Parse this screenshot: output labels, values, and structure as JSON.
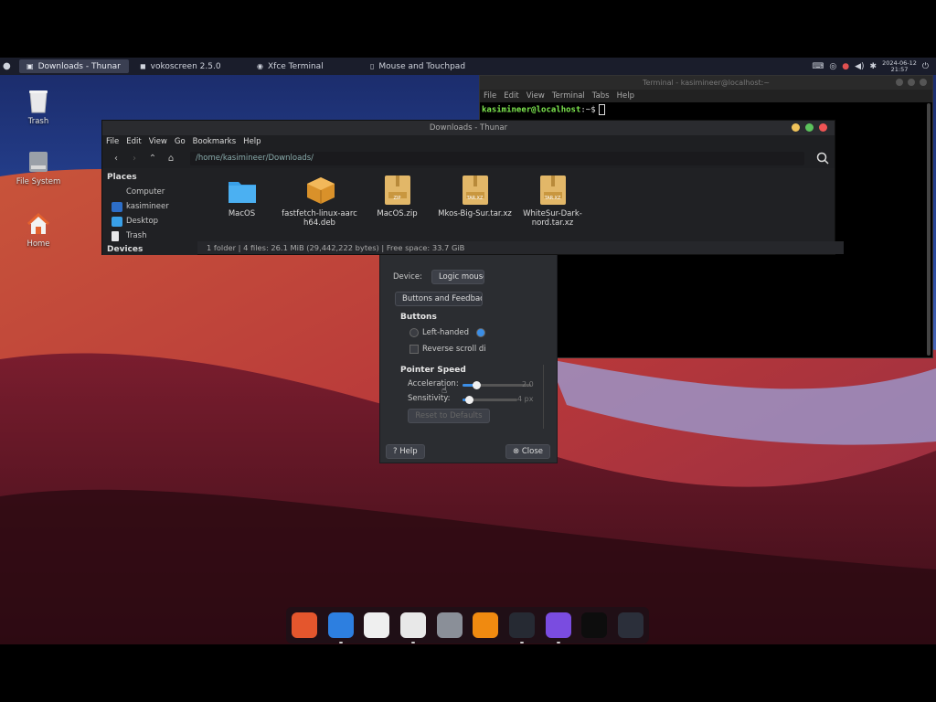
{
  "colors": {
    "panel_bg": "#1a1d2b",
    "terminal_prompt": "#7ee84f",
    "folder_blue": "#39a0e8",
    "archive_tan": "#e2b768",
    "close_red": "#f05454",
    "max_green": "#5cc25c",
    "min_yellow": "#f0c35a"
  },
  "top_panel": {
    "tasks": [
      {
        "label": "Downloads - Thunar",
        "icon": "folder-icon",
        "active": true
      },
      {
        "label": "vokoscreen 2.5.0",
        "icon": "camera-icon",
        "active": false
      },
      {
        "label": "Xfce Terminal",
        "icon": "terminal-icon",
        "active": false
      },
      {
        "label": "Mouse and Touchpad",
        "icon": "mouse-icon",
        "active": false
      }
    ],
    "clock_date": "2024-06-12",
    "clock_time": "21:57"
  },
  "desktop": {
    "icons": [
      {
        "label": "Trash",
        "icon": "trash-icon"
      },
      {
        "label": "File System",
        "icon": "drive-icon"
      },
      {
        "label": "Home",
        "icon": "home-icon"
      }
    ]
  },
  "terminal": {
    "title": "Terminal - kasimineer@localhost:~",
    "menu": [
      "File",
      "Edit",
      "View",
      "Terminal",
      "Tabs",
      "Help"
    ],
    "prompt_user": "kasimineer@localhost",
    "prompt_tail": ":~$"
  },
  "mouse_dialog": {
    "device_label": "Device:",
    "device_value": "Logic mouse",
    "tab": "Buttons and Feedback",
    "buttons_heading": "Buttons",
    "left_handed": "Left-handed",
    "reverse_scroll": "Reverse scroll di",
    "speed_heading": "Pointer Speed",
    "acceleration_label": "Acceleration:",
    "acceleration_value": "2.0",
    "sensitivity_label": "Sensitivity:",
    "sensitivity_value": "4 px",
    "reset_label": "Reset to Defaults",
    "help_label": "Help",
    "close_label": "Close",
    "acceleration_fraction": 0.2,
    "sensitivity_fraction": 0.12
  },
  "thunar": {
    "title": "Downloads - Thunar",
    "menu": [
      "File",
      "Edit",
      "View",
      "Go",
      "Bookmarks",
      "Help"
    ],
    "path": "/home/kasimineer/Downloads/",
    "sidebar": {
      "places_heading": "Places",
      "items": [
        {
          "label": "Computer",
          "icon": "computer-icon"
        },
        {
          "label": "kasimineer",
          "icon": "home-folder-icon"
        },
        {
          "label": "Desktop",
          "icon": "desktop-folder-icon"
        },
        {
          "label": "Trash",
          "icon": "trash-icon"
        }
      ],
      "devices_heading": "Devices"
    },
    "files": [
      {
        "name": "MacOS",
        "icon": "folder-icon",
        "badge": ""
      },
      {
        "name": "fastfetch-linux-aarch64.deb",
        "icon": "package-icon",
        "badge": ""
      },
      {
        "name": "MacOS.zip",
        "icon": "archive-icon",
        "badge": "ZIP"
      },
      {
        "name": "Mkos-Big-Sur.tar.xz",
        "icon": "archive-icon",
        "badge": "TAR.XZ"
      },
      {
        "name": "WhiteSur-Dark-nord.tar.xz",
        "icon": "archive-icon",
        "badge": "TAR.XZ"
      }
    ],
    "status": "1 folder  |  4 files: 26.1 MiB (29,442,222 bytes)  |  Free space: 33.7 GiB"
  },
  "dock": {
    "items": [
      {
        "name": "firefox-icon",
        "bg": "#e4562d",
        "running": false
      },
      {
        "name": "finder-icon",
        "bg": "#2d7fe0",
        "running": true
      },
      {
        "name": "home-icon",
        "bg": "#efefef",
        "running": false
      },
      {
        "name": "mouse-settings-icon",
        "bg": "#e8e8e8",
        "running": true
      },
      {
        "name": "settings-icon",
        "bg": "#8a8f98",
        "running": false
      },
      {
        "name": "vlc-icon",
        "bg": "#f08a10",
        "running": false
      },
      {
        "name": "terminal-icon",
        "bg": "#262a33",
        "running": true
      },
      {
        "name": "screen-recorder-icon",
        "bg": "#7a4ce0",
        "running": true
      },
      {
        "name": "blank-app-icon",
        "bg": "#0d0d0d",
        "running": false
      },
      {
        "name": "app-grid-icon",
        "bg": "#2b2f3a",
        "running": false
      }
    ]
  }
}
